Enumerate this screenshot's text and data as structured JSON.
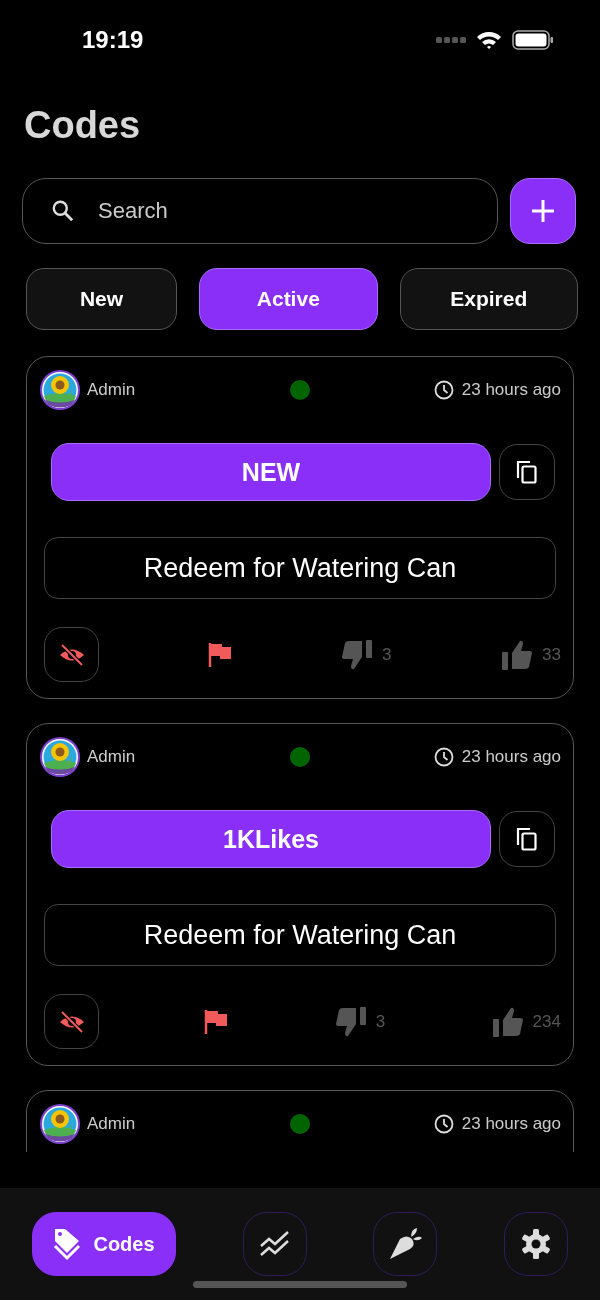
{
  "status_bar": {
    "time": "19:19"
  },
  "title": "Codes",
  "search": {
    "placeholder": "Search"
  },
  "tabs": [
    {
      "label": "New",
      "selected": false
    },
    {
      "label": "Active",
      "selected": true
    },
    {
      "label": "Expired",
      "selected": false
    }
  ],
  "cards": [
    {
      "author": "Admin",
      "color": "#006400",
      "time": "23 hours ago",
      "code": "NEW",
      "description": "Redeem for Watering Can",
      "dislikes": "3",
      "likes": "33"
    },
    {
      "author": "Admin",
      "color": "#006400",
      "time": "23 hours ago",
      "code": "1KLikes",
      "description": "Redeem for Watering Can",
      "dislikes": "3",
      "likes": "234"
    },
    {
      "author": "Admin",
      "color": "#006400",
      "time": "23 hours ago"
    }
  ],
  "nav": [
    {
      "label": "Codes",
      "selected": true
    },
    {
      "selected": false
    },
    {
      "selected": false
    },
    {
      "selected": false
    }
  ]
}
